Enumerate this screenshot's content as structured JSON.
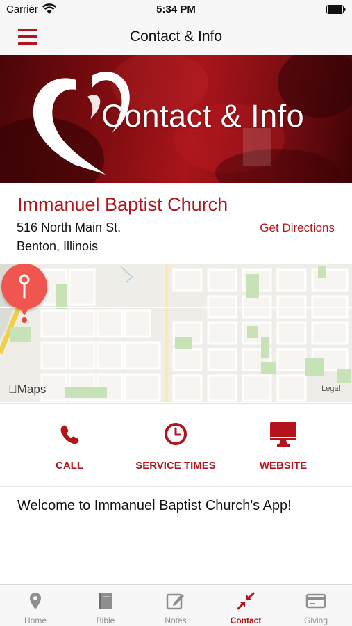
{
  "status_bar": {
    "carrier": "Carrier",
    "time": "5:34 PM"
  },
  "nav": {
    "title": "Contact & Info",
    "menu_icon": "hamburger-menu-icon"
  },
  "banner": {
    "title": "Contact & Info",
    "logo": "heart-swoosh-logo"
  },
  "church": {
    "name": "Immanuel Baptist Church",
    "address_line1": "516 North Main St.",
    "address_line2": "Benton, Illinois",
    "directions_label": "Get Directions"
  },
  "map": {
    "attribution": "Maps",
    "legal": "Legal",
    "pin_icon": "location-pin-icon"
  },
  "actions": [
    {
      "label": "CALL",
      "icon": "phone-icon"
    },
    {
      "label": "SERVICE TIMES",
      "icon": "clock-icon"
    },
    {
      "label": "WEBSITE",
      "icon": "monitor-icon"
    }
  ],
  "welcome": "Welcome to Immanuel Baptist Church's App!",
  "tabs": [
    {
      "label": "Home",
      "icon": "map-marker-icon",
      "active": false
    },
    {
      "label": "Bible",
      "icon": "book-icon",
      "active": false
    },
    {
      "label": "Notes",
      "icon": "edit-note-icon",
      "active": false
    },
    {
      "label": "Contact",
      "icon": "arrows-compress-icon",
      "active": true
    },
    {
      "label": "Giving",
      "icon": "credit-card-icon",
      "active": false
    }
  ],
  "colors": {
    "accent": "#b3141b",
    "inactive_tab": "#8e8e8e",
    "bar_background": "#f7f7f7"
  }
}
